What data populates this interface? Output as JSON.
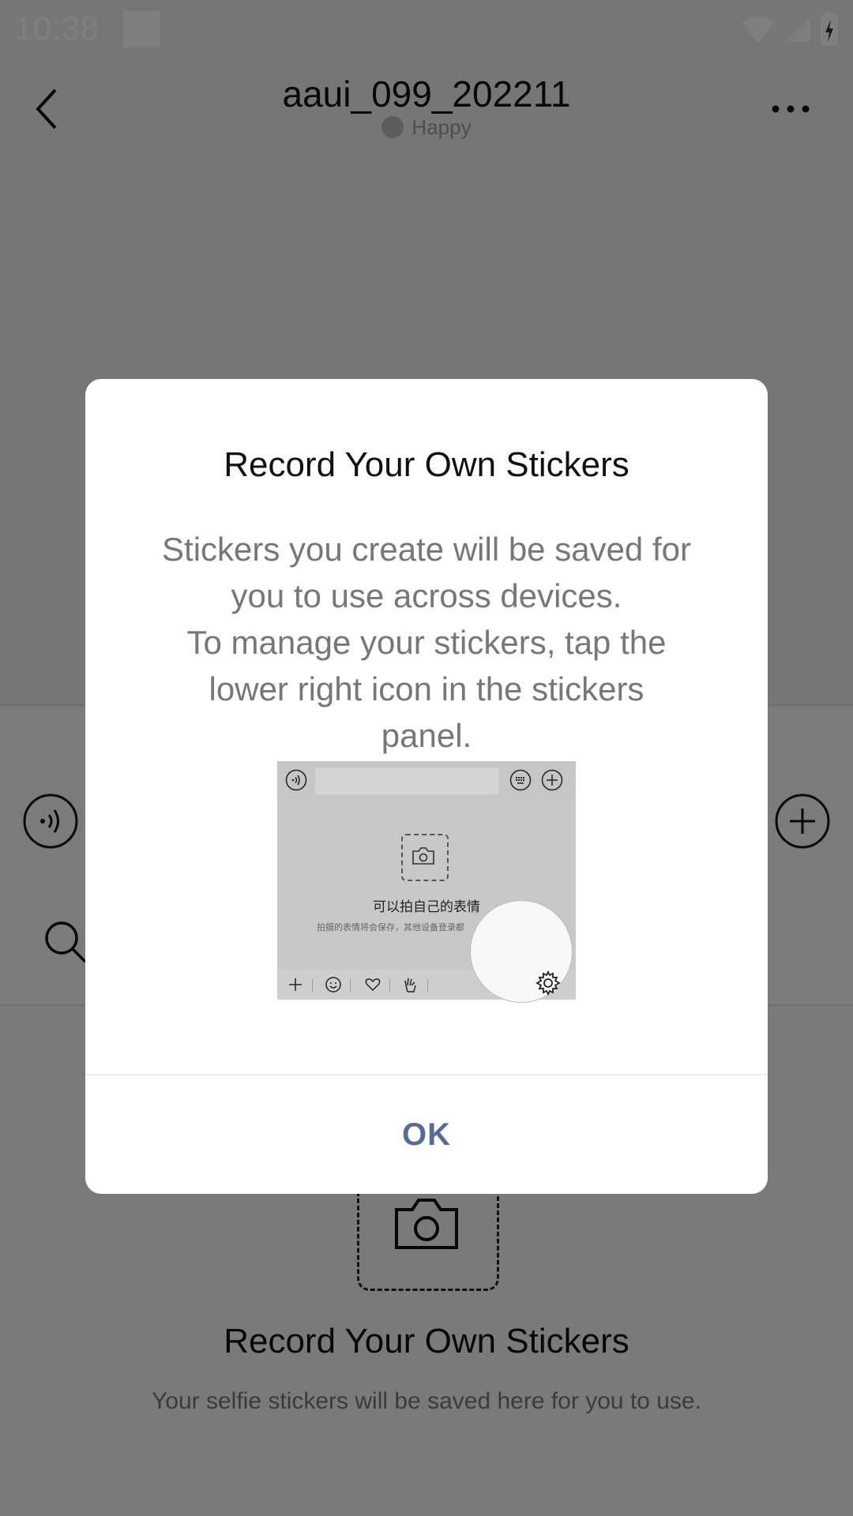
{
  "status_bar": {
    "time": "10:38"
  },
  "header": {
    "title": "aaui_099_202211",
    "status": "Happy"
  },
  "sticker_panel": {
    "title": "Record Your Own Stickers",
    "subtitle": "Your selfie stickers will be saved here for you to use."
  },
  "dialog": {
    "title": "Record Your Own Stickers",
    "body_lines": [
      "Stickers you create will be saved for",
      "you to use across devices.",
      "To manage your stickers, tap the",
      "lower right icon in the stickers",
      "panel."
    ],
    "illustration": {
      "main_text": "可以拍自己的表情",
      "sub_text": "拍摄的表情将会保存，其他设备登录都"
    },
    "ok_label": "OK"
  },
  "colors": {
    "overlay": "rgba(0,0,0,0.5)",
    "ok_accent": "#576b95",
    "body_text": "#777777"
  },
  "icons": [
    "back-icon",
    "more-icon",
    "voice-icon",
    "plus-icon",
    "search-icon",
    "camera-icon",
    "gear-icon",
    "emoji-icon",
    "heart-icon",
    "keyboard-icon"
  ]
}
